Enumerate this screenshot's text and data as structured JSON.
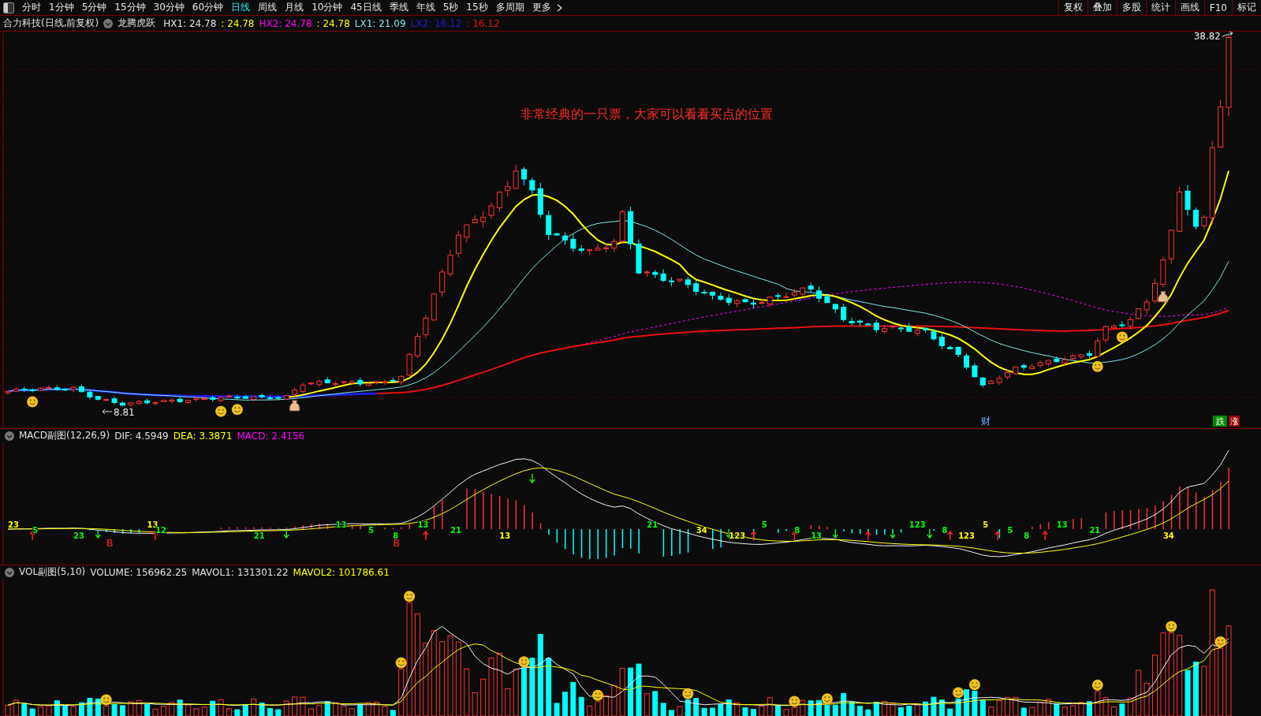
{
  "toolbar": {
    "periods": [
      {
        "label": "分时",
        "selected": false
      },
      {
        "label": "1分钟",
        "selected": false
      },
      {
        "label": "5分钟",
        "selected": false
      },
      {
        "label": "15分钟",
        "selected": false
      },
      {
        "label": "30分钟",
        "selected": false
      },
      {
        "label": "60分钟",
        "selected": false
      },
      {
        "label": "日线",
        "selected": true
      },
      {
        "label": "周线",
        "selected": false
      },
      {
        "label": "月线",
        "selected": false
      },
      {
        "label": "10分钟",
        "selected": false
      },
      {
        "label": "45日线",
        "selected": false
      },
      {
        "label": "季线",
        "selected": false
      },
      {
        "label": "年线",
        "selected": false
      },
      {
        "label": "5秒",
        "selected": false
      },
      {
        "label": "15秒",
        "selected": false
      },
      {
        "label": "多周期",
        "selected": false
      },
      {
        "label": "更多",
        "selected": false
      }
    ],
    "buttons": [
      "复权",
      "叠加",
      "多股",
      "统计",
      "画线",
      "F10",
      "标记"
    ]
  },
  "legend": {
    "stock": "合力科技(日线,前复权)",
    "indicator": "龙腾虎跃",
    "values": [
      {
        "text": "HX1: 24.78",
        "color": "#e0e0e0"
      },
      {
        "text": ": 24.78",
        "color": "#ffff00"
      },
      {
        "text": "HX2: 24.78",
        "color": "#ff00ff"
      },
      {
        "text": ": 24.78",
        "color": "#ffff00"
      },
      {
        "text": "LX1: 21.09",
        "color": "#7fe3e8"
      },
      {
        "text": "LX2: 16.12",
        "color": "#1e1ed2"
      },
      {
        "text": ": 16.12",
        "color": "#e01010"
      }
    ]
  },
  "main_chart": {
    "annotation": "非常经典的一只票，大家可以看看买点的位置",
    "high_label": "38.82",
    "low_label": "8.81",
    "event_mark": "财",
    "badges": [
      {
        "text": "跌",
        "color": "#008800"
      },
      {
        "text": "涨",
        "color": "#990000"
      }
    ]
  },
  "macd": {
    "title": "MACD副图(12,26,9)",
    "values": [
      {
        "text": "DIF: 4.5949",
        "color": "#e0e0e0"
      },
      {
        "text": "DEA: 3.3871",
        "color": "#ffff00"
      },
      {
        "text": "MACD: 2.4156",
        "color": "#ff00ff"
      }
    ],
    "counts": [
      {
        "text": "23",
        "color": "#ffff00"
      },
      {
        "text": "5",
        "color": "#00ff00"
      },
      {
        "text": "23",
        "color": "#00ff00"
      },
      {
        "text": "13",
        "color": "#ffff00"
      },
      {
        "text": "12",
        "color": "#00ff00"
      },
      {
        "text": "21",
        "color": "#00ff00"
      },
      {
        "text": "13",
        "color": "#00ff00"
      },
      {
        "text": "5",
        "color": "#00ff00"
      },
      {
        "text": "8",
        "color": "#00ff00"
      },
      {
        "text": "13",
        "color": "#00ff00"
      },
      {
        "text": "21",
        "color": "#00ff00"
      },
      {
        "text": "13",
        "color": "#ffff00"
      },
      {
        "text": "21",
        "color": "#00ff00"
      },
      {
        "text": "34",
        "color": "#ffff00"
      },
      {
        "text": "123",
        "color": "#ffff00"
      },
      {
        "text": "5",
        "color": "#00ff00"
      },
      {
        "text": "8",
        "color": "#00ff00"
      },
      {
        "text": "13",
        "color": "#00ff00"
      },
      {
        "text": "123",
        "color": "#00ff00"
      },
      {
        "text": "8",
        "color": "#00ff00"
      },
      {
        "text": "123",
        "color": "#ffff00"
      },
      {
        "text": "5",
        "color": "#ffff00"
      },
      {
        "text": "5",
        "color": "#00ff00"
      },
      {
        "text": "8",
        "color": "#00ff00"
      },
      {
        "text": "13",
        "color": "#00ff00"
      },
      {
        "text": "21",
        "color": "#00ff00"
      },
      {
        "text": "34",
        "color": "#ffff00"
      }
    ],
    "buy_marks": [
      "B",
      "B"
    ]
  },
  "volume": {
    "title": "VOL副图(5,10)",
    "values": [
      {
        "text": "VOLUME: 156962.25",
        "color": "#e0e0e0"
      },
      {
        "text": "MAVOL1: 131301.22",
        "color": "#e0e0e0"
      },
      {
        "text": "MAVOL2: 101786.61",
        "color": "#ffff00"
      }
    ]
  }
}
